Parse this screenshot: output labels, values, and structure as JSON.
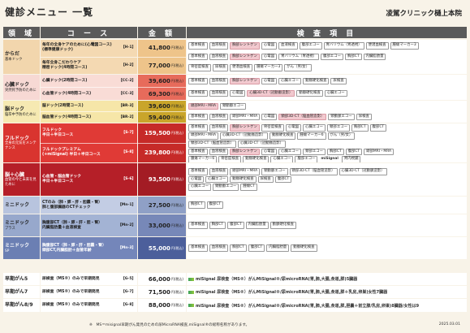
{
  "page_title": "健診メニュー 一覧",
  "clinic_name": "凌駕クリニック樋上本院",
  "header": {
    "area": "領 域",
    "course": "コ ー ス",
    "price": "金 額",
    "exams": "検 査 項 目"
  },
  "price_unit": "円(税込)",
  "colors": {
    "brand": "#b8262d",
    "orange": "#d06a2e",
    "navy": "#2d4a7a"
  },
  "groups": [
    {
      "id": "karada",
      "area_name": "からだ",
      "area_sub": "基本ドック",
      "area_bg": "#f2d6ad",
      "course_bg": "#f4d9b2",
      "price_bg": "#eec48a",
      "text_color": "#222",
      "courses": [
        {
          "name": "毎年の全身ケアのために(心電図コース)",
          "name2": "(標準健康ドック)",
          "code": "【H-1】",
          "price": "41,800",
          "exams": [
            [
              {
                "t": "基本検査"
              },
              {
                "t": "血液検査"
              },
              {
                "t": "胸部レントゲン",
                "c": "pink"
              },
              {
                "t": "心電図"
              },
              {
                "t": "血液検査"
              },
              {
                "t": "腹部エコー"
              },
              {
                "t": "胃バリウム（胃透視）"
              },
              {
                "t": "便潜血検査"
              },
              {
                "t": "腫瘍マーカー3"
              }
            ]
          ]
        },
        {
          "name": "毎年全身こだわりケア",
          "name2": "精密ドック(4時間コース)",
          "code": "【H-2】",
          "price": "77,000",
          "exams": [
            [
              {
                "t": "基本検査"
              },
              {
                "t": "血液検査"
              },
              {
                "t": "胸部レントゲン",
                "c": "pink"
              },
              {
                "t": "心電図"
              },
              {
                "t": "胃バリウム（胃透視）"
              },
              {
                "t": "腹部エコー"
              },
              {
                "t": "胸部CT"
              },
              {
                "t": "内臓脂肪量"
              }
            ],
            [
              {
                "t": "骨密度検査"
              },
              {
                "t": "尿検査"
              },
              {
                "t": "便潜血検査"
              },
              {
                "t": "腫瘍マーカー3"
              },
              {
                "t": "がん（男/女）"
              }
            ]
          ]
        }
      ]
    },
    {
      "id": "heart",
      "area_name": "心臓ドック",
      "area_sub": "突然死予防のために",
      "area_bg": "#f7d9d4",
      "course_bg": "#f9dcd6",
      "price_bg": "#e76b5b",
      "text_color": "#222",
      "courses": [
        {
          "name": "心臓ドック(2時間コース)",
          "name2": "",
          "code": "【CC-2】",
          "price": "39,600",
          "exams": [
            [
              {
                "t": "基本検査"
              },
              {
                "t": "血液検査"
              },
              {
                "t": "胸部レントゲン",
                "c": "pink"
              },
              {
                "t": "心電図"
              },
              {
                "t": "心臓エコー"
              },
              {
                "t": "動脈硬化検査"
              },
              {
                "t": "尿検査"
              }
            ]
          ]
        },
        {
          "name": "心血管ドック(4時間コース)",
          "name2": "",
          "code": "【CC-3】",
          "price": "69,300",
          "exams": [
            [
              {
                "t": "基本検査"
              },
              {
                "t": "血液検査"
              },
              {
                "t": "心電図"
              },
              {
                "t": "心臓3D-CT（冠動脈造影）",
                "c": "pink"
              },
              {
                "t": "動脈硬化検査"
              },
              {
                "t": "心臓エコー"
              }
            ]
          ]
        }
      ]
    },
    {
      "id": "brain",
      "area_name": "脳ドック",
      "area_sub": "脳卒中予防のために",
      "area_bg": "#f6e9b2",
      "course_bg": "#f6e6a8",
      "price_bg": "#c9a52a",
      "text_color": "#222",
      "courses": [
        {
          "name": "脳ドック(2時間コース)",
          "name2": "",
          "code": "【BR-3】",
          "price": "39,600",
          "exams": [
            [
              {
                "t": "頭部MRI・MRA",
                "c": "pink"
              },
              {
                "t": "頸動脈エコー"
              }
            ]
          ]
        },
        {
          "name": "脳血管ドック(4時間コース)",
          "name2": "",
          "code": "【BR-2】",
          "price": "59,400",
          "exams": [
            [
              {
                "t": "基本検査"
              },
              {
                "t": "血液検査"
              },
              {
                "t": "頭部MRI・MRA"
              },
              {
                "t": "心電図"
              },
              {
                "t": "頸部3D-CT（脳血管造影）",
                "c": "pink"
              },
              {
                "t": "頸動脈エコー"
              },
              {
                "t": "尿検査"
              }
            ]
          ]
        }
      ]
    },
    {
      "id": "full",
      "area_name": "フルドック",
      "area_sub": "全身の元気をメンテナンス",
      "area_bg": "#d9342f",
      "course_bg": "#e03a36",
      "price_bg": "#c62a28",
      "text_color": "#fff",
      "courses": [
        {
          "name": "フルドック",
          "name2": "半日＋半日コース",
          "code": "【S-7】",
          "price": "159,500",
          "exams": [
            [
              {
                "t": "基本検査"
              },
              {
                "t": "血液検査"
              },
              {
                "t": "胸部レントゲン",
                "c": "pink"
              },
              {
                "t": "骨密度検査"
              },
              {
                "t": "心電図"
              },
              {
                "t": "心臓エコー"
              },
              {
                "t": "頸部エコー"
              },
              {
                "t": "胸部CT"
              },
              {
                "t": "腹部CT"
              }
            ],
            [
              {
                "t": "頭部MRI・MRA"
              },
              {
                "t": "心臓3D-CT（冠動脈造影）"
              },
              {
                "t": "動脈硬化検査"
              },
              {
                "t": "腫瘍マーカー6"
              },
              {
                "t": "がん（男/女）"
              }
            ],
            [
              {
                "t": "頸部3D-CT（脳血管造影）"
              },
              {
                "t": "心臓3D-CT（冠動脈造影）"
              }
            ]
          ]
        },
        {
          "name": "フルドックプレミアム",
          "name2": "(+miSignal) 半日＋半日コース",
          "code": "【S-8】",
          "price": "239,800",
          "exams": [
            [
              {
                "t": "基本検査"
              },
              {
                "t": "血液検査"
              },
              {
                "t": "胸部レントゲン",
                "c": "pink"
              },
              {
                "t": "心電図"
              },
              {
                "t": "心臓エコー"
              },
              {
                "t": "頸部エコー"
              },
              {
                "t": "胸部CT"
              },
              {
                "t": "腹部CT"
              },
              {
                "t": "頭部MRI・MRA"
              }
            ],
            [
              {
                "t": "腫瘍マーカー6"
              },
              {
                "t": "骨密度検査"
              },
              {
                "t": "動脈硬化検査"
              },
              {
                "t": "心臓エコー"
              },
              {
                "t": "腹部エコー"
              },
              {
                "t": "miSignal",
                "c": "plain"
              },
              {
                "t": "胃内視鏡"
              }
            ],
            [
              {
                "t": "頸部3D-CT（脳血管造影）"
              },
              {
                "t": "心臓3D-CT（冠動脈造影）"
              }
            ]
          ]
        }
      ]
    },
    {
      "id": "brainheart",
      "area_name": "脳＋心臓",
      "area_sub": "血管の今と未来を見ために",
      "area_bg": "#b51f28",
      "course_bg": "#b51f28",
      "price_bg": "#a31c24",
      "text_color": "#fff",
      "courses": [
        {
          "name": "心血管・脳血管ドック",
          "name2": "半日＋半日コース",
          "code": "【S-6】",
          "price": "93,500",
          "exams": [
            [
              {
                "t": "基本検査"
              },
              {
                "t": "血液検査"
              },
              {
                "t": "頭部MRI・MRA"
              },
              {
                "t": "頸動脈エコー"
              },
              {
                "t": "頸部3D-CT（脳血管造影）"
              },
              {
                "t": "心臓3D-CT（冠動脈造影）"
              }
            ],
            [
              {
                "t": "心電図"
              },
              {
                "t": "心臓エコー"
              },
              {
                "t": "動脈硬化検査"
              },
              {
                "t": "尿検査"
              },
              {
                "t": "腹部CT"
              }
            ],
            [
              {
                "t": "心臓エコー"
              },
              {
                "t": "頸動脈エコー"
              },
              {
                "t": "腫瘍CT"
              }
            ]
          ]
        }
      ]
    },
    {
      "id": "mini",
      "area_name": "ミニドック",
      "area_sub": "",
      "area_bg": "#b8c4de",
      "course_bg": "#c3cde4",
      "price_bg": "#8fa0c6",
      "text_color": "#222",
      "courses": [
        {
          "name": "CTのみ（肺・膵・肝・胆嚢・腎）",
          "name2": "肺と腹部臓器のCTチェック",
          "code": "【Mn-1】",
          "price": "27,500",
          "exams": [
            [
              {
                "t": "胸部CT"
              },
              {
                "t": "腹部CT"
              }
            ]
          ]
        }
      ]
    },
    {
      "id": "miniplus",
      "area_name": "ミニドック",
      "area_sub": "プラス",
      "area_bg": "#97a8cc",
      "course_bg": "#a3b3d4",
      "price_bg": "#7788b8",
      "text_color": "#222",
      "courses": [
        {
          "name": "胸腹部CT（肺・膵・肝・胆・腎）",
          "name2": "内臓脂肪量＋血液検査",
          "code": "【Mn-2】",
          "price": "33,000",
          "exams": [
            [
              {
                "t": "基本検査"
              },
              {
                "t": "胸部CT"
              },
              {
                "t": "腹部CT"
              },
              {
                "t": "内臓脂肪量"
              },
              {
                "t": "動脈硬化検査"
              }
            ]
          ]
        }
      ]
    },
    {
      "id": "minisp",
      "area_name": "ミニドック",
      "area_sub": "SP",
      "area_bg": "#6b7fb3",
      "course_bg": "#7486ba",
      "price_bg": "#4c5f9b",
      "text_color": "#fff",
      "courses": [
        {
          "name": "胸腹部CT（肺・膵・肝・胆嚢・腎）",
          "name2": "頭部CT,内臓脂肪＋血管年齢",
          "code": "【Mn-3】",
          "price": "55,000",
          "exams": [
            [
              {
                "t": "基本検査"
              },
              {
                "t": "血液検査"
              },
              {
                "t": "胸部CT"
              },
              {
                "t": "腹部CT"
              },
              {
                "t": "内臓脂肪量"
              },
              {
                "t": "動脈硬化検査"
              }
            ]
          ]
        }
      ]
    },
    {
      "id": "early5",
      "area_name": "早期がん5",
      "area_sub": "",
      "area_bg": "#ffffff",
      "course_bg": "#ffffff",
      "price_bg": "#ffffff",
      "text_color": "#222",
      "courses": [
        {
          "name": "尿検査（MS®）のみで早期発見",
          "name2": "",
          "code": "【G-5】",
          "price": "66,000",
          "exams": [
            [
              {
                "t": "miSignal 尿検査（MS®）がんMiSignal®/尿microRNA(胃,肺,大腸,食道,膵)5臓器",
                "c": "ms"
              }
            ]
          ]
        }
      ]
    },
    {
      "id": "early7",
      "area_name": "早期がん7",
      "area_sub": "",
      "area_bg": "#ffffff",
      "course_bg": "#ffffff",
      "price_bg": "#ffffff",
      "text_color": "#222",
      "courses": [
        {
          "name": "尿検査（MS®）のみで早期発見",
          "name2": "",
          "code": "【G-7】",
          "price": "71,500",
          "exams": [
            [
              {
                "t": "miSignal 尿検査（MS®）がんMiSignal®/尿microRNA(胃,肺,大腸,食道,膵＋乳房,卵巣)女性7臓器",
                "c": "ms"
              }
            ]
          ]
        }
      ]
    },
    {
      "id": "early8",
      "area_name": "早期がん8/9",
      "area_sub": "",
      "area_bg": "#ffffff",
      "course_bg": "#ffffff",
      "price_bg": "#ffffff",
      "text_color": "#222",
      "courses": [
        {
          "name": "尿検査（MS®）のみで早期発見",
          "name2": "",
          "code": "【G-8】",
          "price": "88,000",
          "exams": [
            [
              {
                "t": "miSignal 尿検査（MS®）がんMiSignal®/尿microRNA(胃,肺,大腸,食道,膵,胆嚢＋前立腺/乳房,卵巣)8臓器/女性は9",
                "c": "ms"
              }
            ]
          ]
        }
      ]
    }
  ],
  "footnote": "※　MS＝misignal早期がん発見のための尿MicroRNA検査,miSignal®の総称名称があります。",
  "date": "2025.03.01"
}
